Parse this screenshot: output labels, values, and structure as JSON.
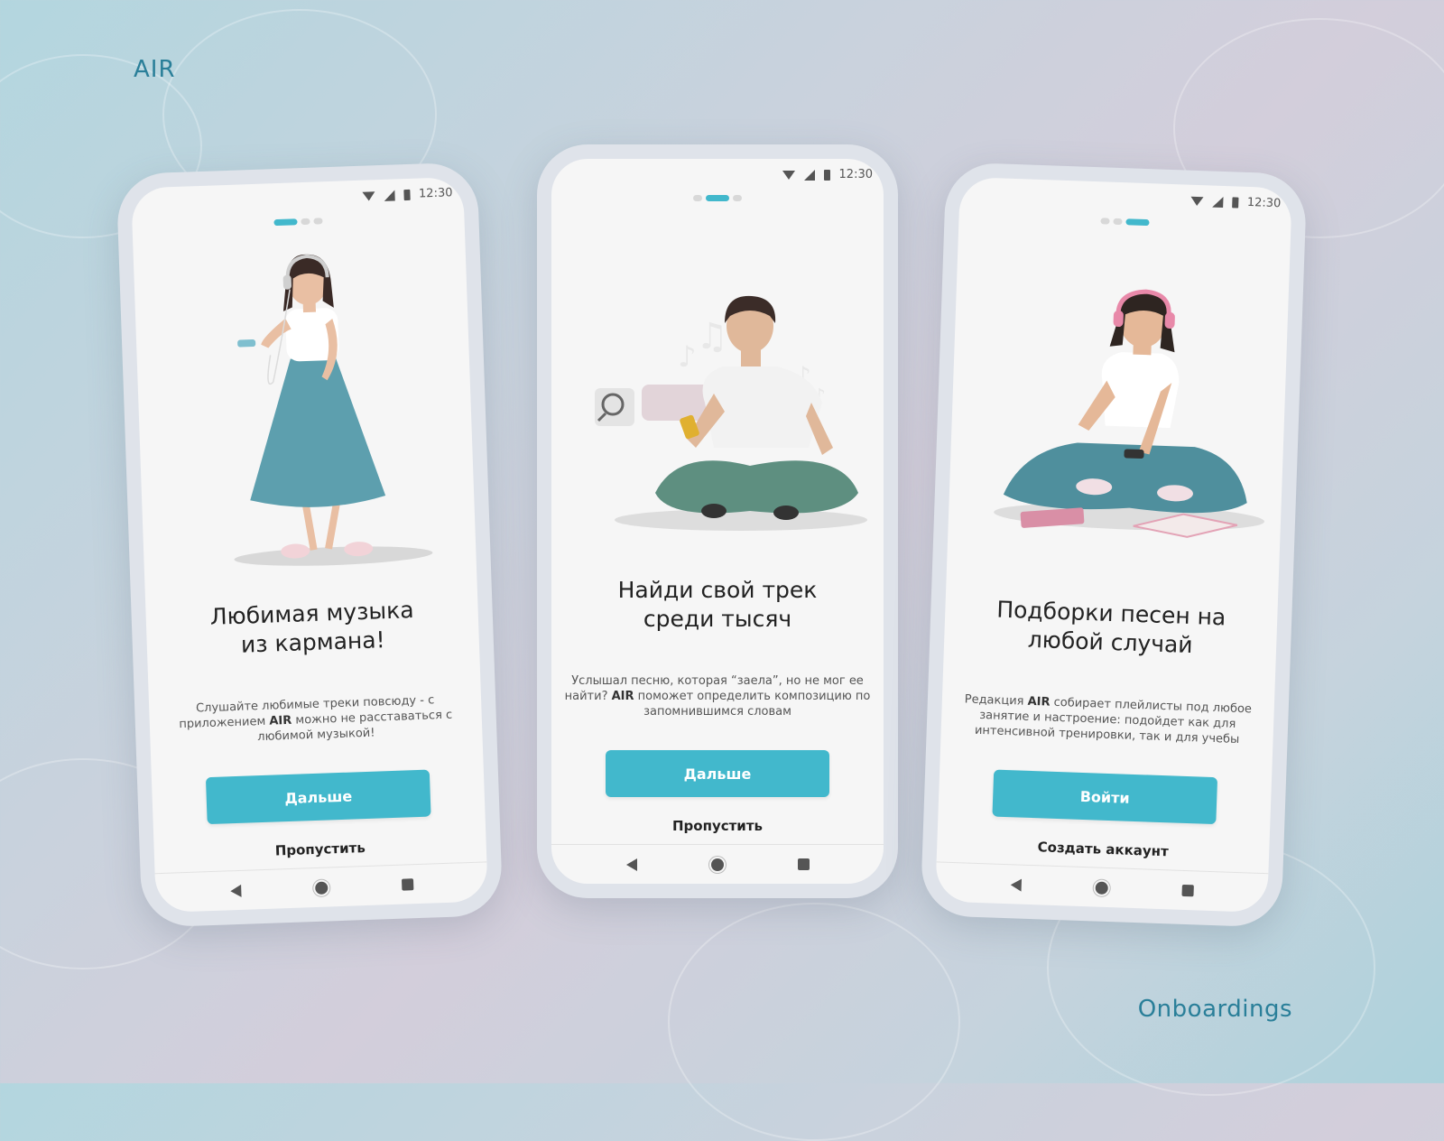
{
  "brand": "AIR",
  "caption": "Onboardings",
  "colors": {
    "accent": "#42b8cc",
    "brand_text": "#2a7f99",
    "background": "#c9d2dd"
  },
  "screens": [
    {
      "status": {
        "time": "12:30"
      },
      "pager": {
        "total": 3,
        "active": 1
      },
      "illustration": "girl-walking-with-headphones-illustration",
      "title": "Любимая музыка\nиз кармана!",
      "description_pre": "Слушайте любимые треки повсюду - с приложением ",
      "description_brand": "AIR",
      "description_post": " можно не расставаться с любимой музыкой!",
      "primary_button": "Дальше",
      "secondary_link": "Пропустить"
    },
    {
      "status": {
        "time": "12:30"
      },
      "pager": {
        "total": 3,
        "active": 2
      },
      "illustration": "boy-sitting-with-phone-search-illustration",
      "title": "Найди свой трек\nсреди тысяч",
      "description_pre": "Услышал песню, которая “заела”, но не мог ее найти? ",
      "description_brand": "AIR",
      "description_post": " поможет определить композицию по запомнившимся словам",
      "primary_button": "Дальше",
      "secondary_link": "Пропустить"
    },
    {
      "status": {
        "time": "12:30"
      },
      "pager": {
        "total": 3,
        "active": 3
      },
      "illustration": "girl-sitting-with-books-illustration",
      "title": "Подборки песен на\nлюбой случай",
      "description_pre": "Редакция ",
      "description_brand": "AIR",
      "description_post": " собирает плейлисты под любое занятие и настроение: подойдет как для интенсивной тренировки, так и для учебы",
      "primary_button": "Войти",
      "secondary_link": "Создать аккаунт"
    }
  ],
  "icons": {
    "wifi": "wifi-icon",
    "signal": "signal-icon",
    "battery": "battery-icon",
    "back": "nav-back-icon",
    "home": "nav-home-icon",
    "recents": "nav-recents-icon"
  }
}
